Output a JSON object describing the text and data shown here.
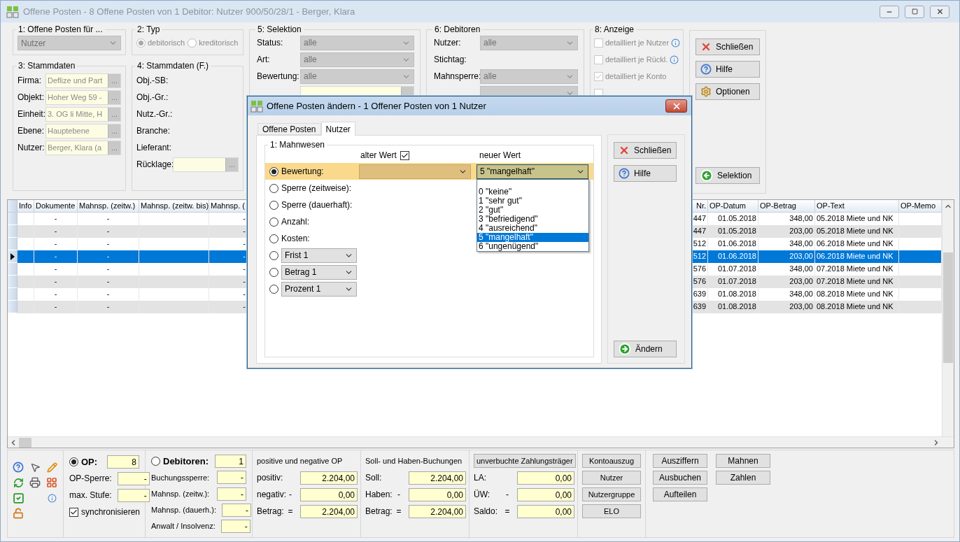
{
  "window": {
    "title": "Offene Posten - 8 Offene Posten von 1 Debitor:  Nutzer 900/50/28/1 - Berger, Klara"
  },
  "offene_posten_fuer": {
    "title": "1: Offene Posten für ...",
    "value": "Nutzer"
  },
  "typ": {
    "title": "2: Typ",
    "options": [
      {
        "label": "debitorisch",
        "selected": true
      },
      {
        "label": "kreditorisch",
        "selected": false
      }
    ]
  },
  "stammdaten": {
    "title": "3: Stammdaten",
    "fields": [
      {
        "label": "Firma:",
        "value": "Deflize und Part",
        "button": "..."
      },
      {
        "label": "Objekt:",
        "value": "Hoher Weg 59 -",
        "button": "..."
      },
      {
        "label": "Einheit:",
        "value": "3. OG li Mitte, H",
        "button": "..."
      },
      {
        "label": "Ebene:",
        "value": "Hauptebene",
        "button": "..."
      },
      {
        "label": "Nutzer:",
        "value": "Berger, Klara  (a",
        "button": "..."
      }
    ]
  },
  "stammdaten_f": {
    "title": "4: Stammdaten (F.)",
    "labels": [
      "Obj.-SB:",
      "Obj.-Gr.:",
      "Nutz.-Gr.:",
      "Branche:",
      "Lieferant:"
    ],
    "ruecklage": {
      "label": "Rücklage:",
      "button": "..."
    }
  },
  "selektion": {
    "title": "5: Selektion",
    "rows": [
      {
        "kind": "select",
        "label": "Status:",
        "value": "alle"
      },
      {
        "kind": "select",
        "label": "Art:",
        "value": "alle"
      },
      {
        "kind": "select",
        "label": "Bewertung:",
        "value": "alle"
      },
      {
        "kind": "field"
      }
    ]
  },
  "debitoren": {
    "title": "6: Debitoren",
    "rows": [
      {
        "kind": "select",
        "label": "Nutzer:",
        "value": "alle"
      },
      {
        "kind": "text",
        "label": "Stichtag:"
      },
      {
        "kind": "select",
        "label": "Mahnsperre:",
        "value": "alle"
      },
      {
        "kind": "select"
      }
    ]
  },
  "anzeige": {
    "title": "8: Anzeige",
    "options": [
      {
        "label": "detailliert je Nutzer",
        "checked": false,
        "info": true
      },
      {
        "label": "detailliert je Rückl.",
        "checked": false,
        "info": true
      },
      {
        "label": "detailliert je Konto",
        "checked": true,
        "info": false
      },
      {
        "checked": false,
        "info": false
      }
    ]
  },
  "side_buttons": [
    {
      "kind": "close",
      "label": "Schließen"
    },
    {
      "kind": "help",
      "label": "Hilfe"
    },
    {
      "kind": "options",
      "label": "Optionen"
    },
    {
      "kind": "back",
      "label": "Selektion"
    }
  ],
  "table": {
    "columns_left": [
      "Info",
      "Dokumente",
      "Mahnsp. (zeitw.)",
      "Mahnsp. (zeitw. bis)",
      "Mahnsp. ("
    ],
    "columns_right": [
      "Nr.",
      "OP-Datum",
      "OP-Betrag",
      "OP-Text",
      "OP-Memo"
    ],
    "rows": [
      {
        "selected": false,
        "dokumente": "-",
        "mahnsp_zeitw": "-",
        "mahnsp_d": "-",
        "nr": "447",
        "datum": "01.05.2018",
        "betrag": "348,00",
        "text": "05.2018 Miete und NK"
      },
      {
        "selected": false,
        "dokumente": "-",
        "mahnsp_zeitw": "-",
        "mahnsp_d": "-",
        "nr": "447",
        "datum": "01.05.2018",
        "betrag": "203,00",
        "text": "05.2018 Miete und NK"
      },
      {
        "selected": false,
        "dokumente": "-",
        "mahnsp_zeitw": "-",
        "mahnsp_d": "-",
        "nr": "512",
        "datum": "01.06.2018",
        "betrag": "348,00",
        "text": "06.2018 Miete und NK"
      },
      {
        "selected": true,
        "dokumente": "-",
        "mahnsp_zeitw": "-",
        "mahnsp_d": "-",
        "nr": "512",
        "datum": "01.06.2018",
        "betrag": "203,00",
        "text": "06.2018 Miete und NK"
      },
      {
        "selected": false,
        "dokumente": "-",
        "mahnsp_zeitw": "-",
        "mahnsp_d": "-",
        "nr": "576",
        "datum": "01.07.2018",
        "betrag": "348,00",
        "text": "07.2018 Miete und NK"
      },
      {
        "selected": false,
        "dokumente": "-",
        "mahnsp_zeitw": "-",
        "mahnsp_d": "-",
        "nr": "576",
        "datum": "01.07.2018",
        "betrag": "203,00",
        "text": "07.2018 Miete und NK"
      },
      {
        "selected": false,
        "dokumente": "-",
        "mahnsp_zeitw": "-",
        "mahnsp_d": "-",
        "nr": "639",
        "datum": "01.08.2018",
        "betrag": "348,00",
        "text": "08.2018 Miete und NK"
      },
      {
        "selected": false,
        "dokumente": "-",
        "mahnsp_zeitw": "-",
        "mahnsp_d": "-",
        "nr": "639",
        "datum": "01.08.2018",
        "betrag": "203,00",
        "text": "08.2018 Miete und NK"
      }
    ]
  },
  "bottom": {
    "op": {
      "label": "OP:",
      "selected": true,
      "value": "8",
      "rows": [
        {
          "label": "OP-Sperre:",
          "value": "-"
        },
        {
          "label": "max. Stufe:",
          "value": "-"
        }
      ],
      "sync": {
        "label": "synchronisieren",
        "checked": true
      }
    },
    "debitoren": {
      "label": "Debitoren:",
      "selected": false,
      "value": "1",
      "rows": [
        {
          "label": "Buchungssperre:",
          "value": "-"
        },
        {
          "label": "Mahnsp. (zeitw.):",
          "value": "-"
        },
        {
          "label": "Mahnsp. (dauerh.):",
          "value": "-"
        },
        {
          "label": "Anwalt / Insolvenz:",
          "value": "-"
        }
      ]
    },
    "sums": [
      {
        "kind": "title",
        "title": "positive und negative OP",
        "rows": [
          {
            "label": "positiv:",
            "value": "2.204,00"
          },
          {
            "label": "negativ:",
            "sign": "-",
            "value": "0,00"
          },
          {
            "label": "Betrag:",
            "sign": "=",
            "value": "2.204,00"
          }
        ]
      },
      {
        "kind": "title",
        "title": "Soll- und Haben-Buchungen",
        "rows": [
          {
            "label": "Soll:",
            "value": "2.204,00"
          },
          {
            "label": "Haben:",
            "sign": "-",
            "value": "0,00"
          },
          {
            "label": "Betrag:",
            "sign": "=",
            "value": "2.204,00"
          }
        ]
      },
      {
        "kind": "button",
        "title": "unverbuchte Zahlungsträger",
        "rows": [
          {
            "label": "LA:",
            "value": "0,00"
          },
          {
            "label": "ÜW:",
            "sign": "-",
            "value": "0,00"
          },
          {
            "label": "Saldo:",
            "sign": "=",
            "value": "0,00"
          }
        ]
      }
    ],
    "buttons_a": [
      "Kontoauszug",
      "Nutzer",
      "Nutzergruppe",
      "ELO"
    ],
    "buttons_b": [
      "Ausziffern",
      "Mahnen",
      "Ausbuchen",
      "Zahlen",
      "Aufteilen"
    ]
  },
  "modal": {
    "title": "Offene Posten ändern - 1 Offener Posten von 1 Nutzer",
    "tabs": [
      {
        "label": "Offene Posten",
        "selected": false
      },
      {
        "label": "Nutzer",
        "selected": true
      }
    ],
    "group_title": "1: Mahnwesen",
    "old_header": {
      "label": "alter Wert",
      "checked": true
    },
    "new_header": "neuer Wert",
    "rows": [
      {
        "kind": "label",
        "label": "Bewertung:",
        "selected": true
      },
      {
        "kind": "label",
        "label": "Sperre (zeitweise):",
        "selected": false
      },
      {
        "kind": "label",
        "label": "Sperre (dauerhaft):",
        "selected": false
      },
      {
        "kind": "label",
        "label": "Anzahl:",
        "selected": false
      },
      {
        "kind": "label",
        "label": "Kosten:",
        "selected": false
      },
      {
        "kind": "select",
        "label": "Frist 1",
        "selected": false
      },
      {
        "kind": "select",
        "label": "Betrag 1",
        "selected": false
      },
      {
        "kind": "select",
        "label": "Prozent 1",
        "selected": false
      }
    ],
    "new_value": {
      "value": "5 \"mangelhaft\"",
      "expanded": true,
      "options": [
        {
          "label": "0 \"keine\"",
          "selected": false
        },
        {
          "label": "1 \"sehr gut\"",
          "selected": false
        },
        {
          "label": "2 \"gut\"",
          "selected": false
        },
        {
          "label": "3 \"befriedigend\"",
          "selected": false
        },
        {
          "label": "4 \"ausreichend\"",
          "selected": false
        },
        {
          "label": "5 \"mangelhaft\"",
          "selected": true
        },
        {
          "label": "6 \"ungenügend\"",
          "selected": false
        }
      ]
    },
    "buttons": [
      {
        "kind": "close",
        "label": "Schließen"
      },
      {
        "kind": "help",
        "label": "Hilfe"
      },
      {
        "kind": "apply",
        "label": "Ändern"
      }
    ]
  }
}
